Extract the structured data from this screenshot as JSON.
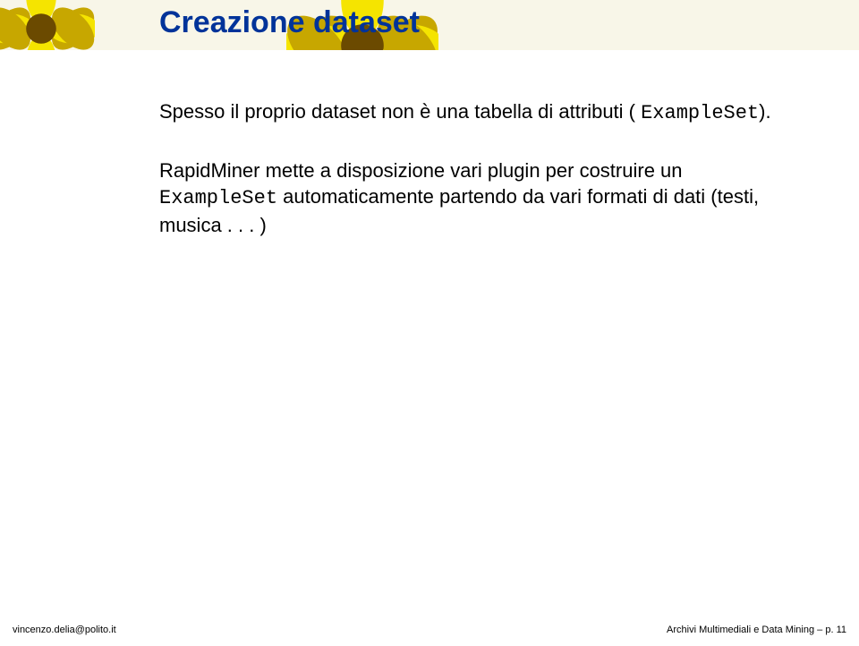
{
  "slide": {
    "title": "Creazione dataset",
    "p1_a": "Spesso il proprio dataset non è una tabella di attributi ( ",
    "p1_code": "ExampleSet",
    "p1_b": ").",
    "p2_a": "RapidMiner mette a disposizione vari plugin per costruire un ",
    "p2_code": "ExampleSet",
    "p2_b": " automaticamente partendo da vari formati di dati (testi, musica . . . )"
  },
  "footer": {
    "left": "vincenzo.delia@polito.it",
    "right": "Archivi Multimediali e Data Mining – p. 11"
  }
}
